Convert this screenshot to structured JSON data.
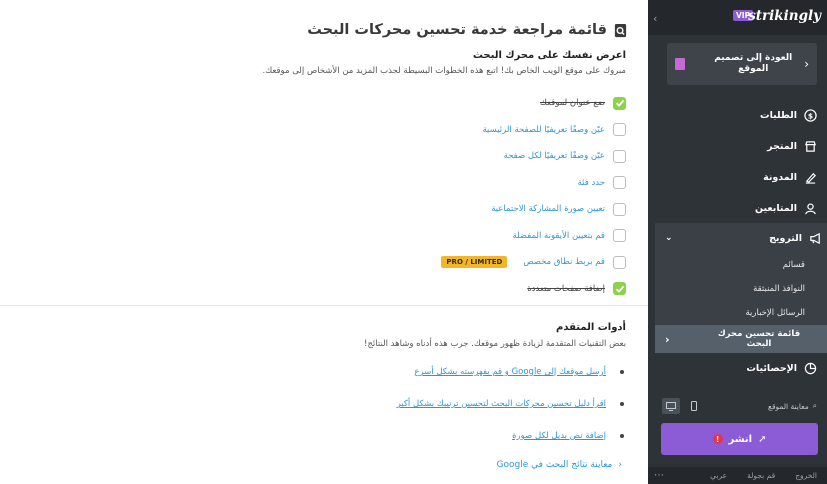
{
  "main": {
    "title": "قائمة مراجعة خدمة تحسين محركات البحث",
    "intro_heading": "اعرض نفسك على محرك البحث",
    "intro_description": "مبروك على موقع الويب الخاص بك! اتبع هذه الخطوات البسيطة لجذب المزيد من الأشخاص إلى موقعك.",
    "checklist": [
      {
        "label": "ضع عنوان لموقعك",
        "checked": true
      },
      {
        "label": "عيّن وصفًا تعريفيًا للصفحة الرئيسية",
        "checked": false
      },
      {
        "label": "عيّن وصفًا تعريفيًا لكل صفحة",
        "checked": false
      },
      {
        "label": "حدد فئة",
        "checked": false
      },
      {
        "label": "تعيين صورة المشاركة الاجتماعية",
        "checked": false
      },
      {
        "label": "قم بتعيين الأيقونة المفضلة",
        "checked": false
      },
      {
        "label": "قم بربط نطاق مخصص",
        "checked": false,
        "badge": "PRO / LIMITED"
      },
      {
        "label": "إضافة صفحات متعددة",
        "checked": true
      }
    ],
    "advanced_heading": "أدوات المتقدم",
    "advanced_description": "بعض التقنيات المتقدمة لزيادة ظهور موقعك. جرب هذه أدناه وشاهد النتائج!",
    "advanced_links": [
      "أرسل موقعك إلى Google و قم بفهرسته بشكل أسرع",
      "اقرأ دليل تحسين محركات البحث لتحسين ترتيبك بشكل أكبر",
      "إضافة نص بديل لكل صورة"
    ],
    "preview_link": "معاينة نتائج البحث في Google"
  },
  "sidebar": {
    "logo": "strikingly",
    "vip": "VIP",
    "back_label": "العودة إلى تصميم الموقع",
    "nav": [
      {
        "label": "الطلبات",
        "icon": "dollar-icon"
      },
      {
        "label": "المتجر",
        "icon": "store-icon"
      },
      {
        "label": "المدونة",
        "icon": "pen-icon"
      },
      {
        "label": "المتابعين",
        "icon": "users-icon"
      }
    ],
    "promotion": {
      "label": "الترويج",
      "icon": "megaphone-icon",
      "items": [
        "قسائم",
        "النوافذ المنبثقة",
        "الرسائل الإخبارية"
      ],
      "active_item": "قائمة تحسين محرك البحث"
    },
    "stats_label": "الإحصائيات",
    "site_preview": "معاينة الموقع",
    "publish": "انشر",
    "footer": [
      "الخروج",
      "قم بجولة",
      "عربي"
    ],
    "colors": {
      "accent": "#8b5cd6",
      "sidebar": "#2e3338",
      "link": "#2f96d5",
      "check": "#8bd34a",
      "badge": "#f0b72b"
    }
  }
}
